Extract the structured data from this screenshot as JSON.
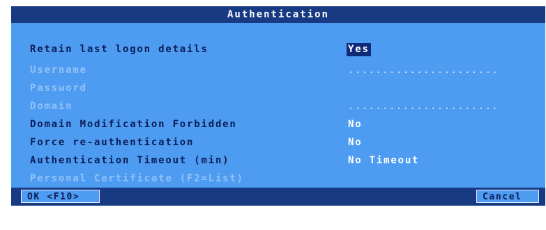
{
  "dialog": {
    "title": "Authentication"
  },
  "fields": {
    "retain_logon": {
      "label": "Retain last logon details",
      "value": "Yes"
    },
    "username": {
      "label": "Username",
      "value": "......................"
    },
    "password": {
      "label": "Password",
      "value": ""
    },
    "domain": {
      "label": "Domain",
      "value": "......................"
    },
    "domain_forbidden": {
      "label": "Domain Modification Forbidden",
      "value": "No"
    },
    "force_reauth": {
      "label": "Force re-authentication",
      "value": "No"
    },
    "auth_timeout": {
      "label": "Authentication Timeout (min)",
      "value": "No Timeout"
    },
    "personal_cert": {
      "label": "Personal Certificate (F2=List)",
      "value": ""
    }
  },
  "buttons": {
    "ok_label": "OK <F10>",
    "cancel_label": "Cancel"
  },
  "colors": {
    "dialog_background": "#4e9cf1",
    "title_bar": "#173a82",
    "enabled_label": "#0a1c55",
    "disabled_label": "#93c2f7",
    "value_text": "#ffffff",
    "selection": "#0e2a78"
  }
}
